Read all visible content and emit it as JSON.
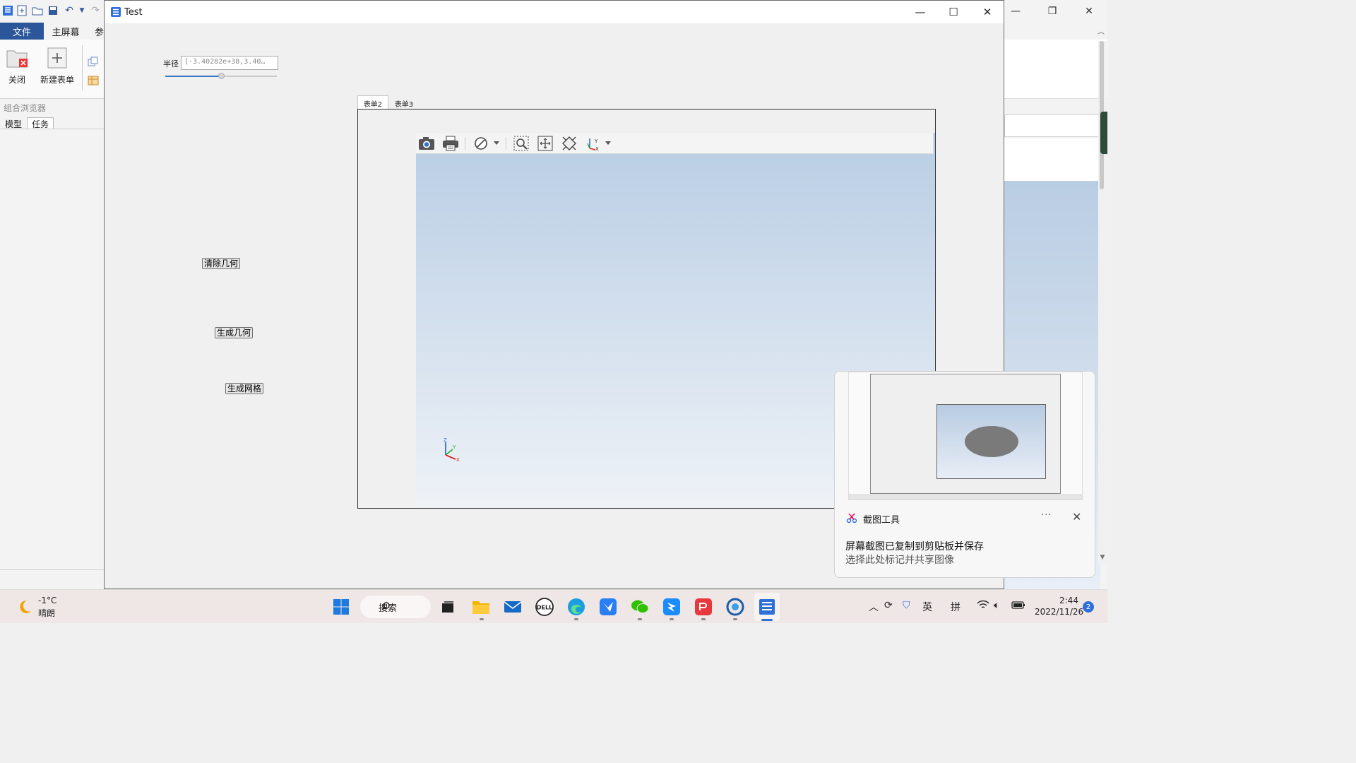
{
  "background_app": {
    "ribbon_tabs": {
      "file": "文件",
      "home": "主屏幕",
      "more": "参"
    },
    "ribbon_buttons": {
      "close": "关闭",
      "new_form": "新建表单"
    },
    "combo_browser": {
      "title": "组合浏览器",
      "tab_model": "模型",
      "tab_task": "任务"
    }
  },
  "test_window": {
    "title": "Test",
    "radius_label": "半径",
    "radius_value": "[-3.40282e+38,3.40…",
    "slider_position": 0.5,
    "buttons": {
      "clear": "清除几何",
      "generate": "生成几何",
      "mesh": "生成网格"
    },
    "form_tabs": [
      "表单2",
      "表单3"
    ],
    "selected_tab": "表单2",
    "triad": {
      "z": "Z",
      "y": "Y",
      "x": "X"
    }
  },
  "toast": {
    "app_name": "截图工具",
    "more": "···",
    "line1": "屏幕截图已复制到剪贴板并保存",
    "line2": "选择此处标记并共享图像"
  },
  "taskbar": {
    "weather_temp": "-1°C",
    "weather_desc": "晴朗",
    "search_label": "搜索",
    "ime_lang": "英",
    "ime_mode": "拼",
    "time": "2:44",
    "date": "2022/11/26",
    "notification_count": "2",
    "pinned": [
      "windows-start",
      "task-view",
      "file-explorer",
      "mail",
      "dell",
      "edge",
      "feishu",
      "wechat",
      "dingtalk",
      "wps",
      "vpn",
      "test-app"
    ]
  },
  "colors": {
    "ribbon_accent": "#2b579a",
    "viewport_top": "#b8cde4",
    "viewport_bottom": "#eef2f7",
    "taskbar": "#efe6e6",
    "active_indicator": "#2f6fd8"
  }
}
